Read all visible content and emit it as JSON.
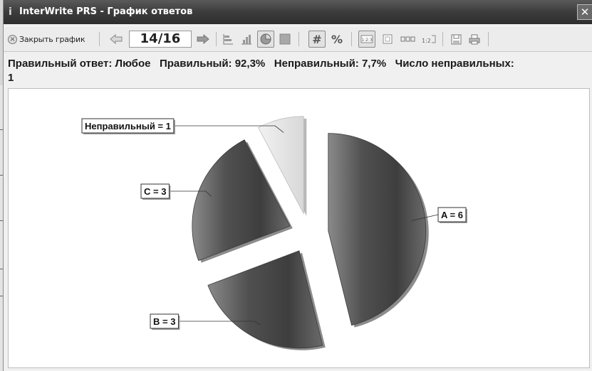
{
  "window": {
    "title": "InterWrite PRS - График ответов",
    "close_symbol": "✕"
  },
  "toolbar": {
    "close_chart_label": "Закрыть график",
    "page_indicator": "14/16",
    "icons": [
      "close-circle-icon",
      "arrow-left-icon",
      "arrow-right-icon",
      "bar-chart-icon",
      "column-chart-icon",
      "pie-chart-icon",
      "area-chart-icon",
      "count-icon",
      "percent-icon",
      "numbered-1-2-3-icon",
      "label-icon",
      "answer-strip-icon",
      "order-1-2-3-icon",
      "save-icon",
      "print-icon"
    ],
    "count_symbol": "#",
    "percent_symbol": "%"
  },
  "info": {
    "correct_answer": "Правильный ответ: Любое",
    "correct_pct": "Правильный: 92,3%",
    "incorrect_pct": "Неправильный: 7,7%",
    "incorrect_count_label": "Число неправильных:",
    "incorrect_count_value": "1"
  },
  "chart_data": {
    "type": "pie",
    "exploded": true,
    "categories": [
      "A",
      "B",
      "C",
      "Неправильный"
    ],
    "values": [
      6,
      3,
      3,
      1
    ],
    "labels": [
      "A = 6",
      "B = 3",
      "C = 3",
      "Неправильный = 1"
    ],
    "colors": [
      "#4a4a4a",
      "#4a4a4a",
      "#5a5a5a",
      "#e2e2e2"
    ]
  }
}
